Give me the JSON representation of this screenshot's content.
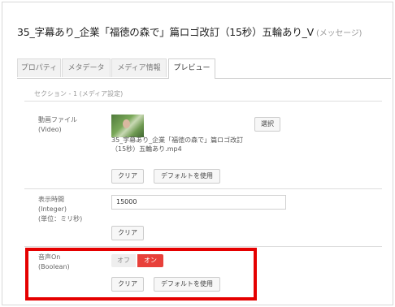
{
  "header": {
    "title": "35_字幕あり_企業「福徳の森で」篇ロゴ改訂（15秒）五輪あり_V",
    "subtitle": "(メッセージ)"
  },
  "tabs": [
    {
      "label": "プロパティ",
      "active": false
    },
    {
      "label": "メタデータ",
      "active": false
    },
    {
      "label": "メディア情報",
      "active": false
    },
    {
      "label": "プレビュー",
      "active": true
    }
  ],
  "section": {
    "label": "セクション - 1 (メディア設定)"
  },
  "fields": {
    "video": {
      "label": "動画ファイル",
      "type": "(Video)",
      "filename_line1": "35_字幕あり_企業「福徳の森で」篇ロゴ改訂",
      "filename_line2": "（15秒）五輪あり.mp4",
      "select_button": "選択",
      "clear_button": "クリア",
      "default_button": "デフォルトを使用"
    },
    "duration": {
      "label": "表示時間",
      "type": "(Integer)",
      "unit": "(単位：ミリ秒)",
      "value": "15000",
      "clear_button": "クリア"
    },
    "audio": {
      "label": "音声On",
      "type": "(Boolean)",
      "off_label": "オフ",
      "on_label": "オン",
      "selected": "on",
      "clear_button": "クリア",
      "default_button": "デフォルトを使用"
    }
  },
  "colors": {
    "accent_on": "#e8403a",
    "highlight_box": "#e50000"
  }
}
